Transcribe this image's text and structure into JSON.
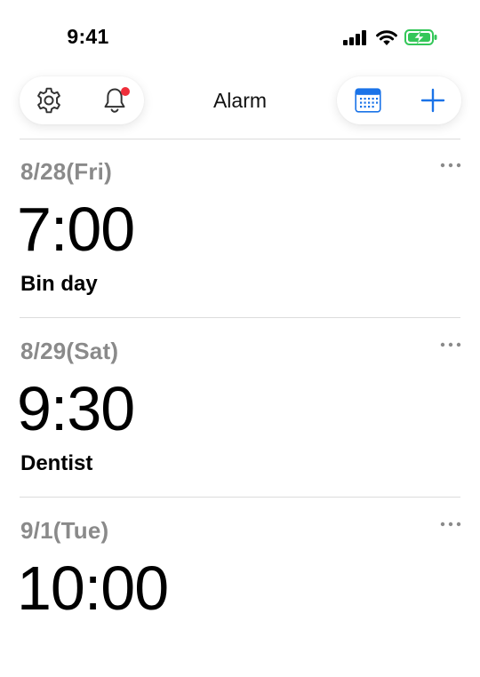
{
  "status_bar": {
    "time": "9:41",
    "icons": [
      "cellular-signal-icon",
      "wifi-icon",
      "battery-charging-icon"
    ],
    "battery_color": "#34c759"
  },
  "header": {
    "title": "Alarm",
    "left_buttons": [
      "gear-icon",
      "bell-icon"
    ],
    "right_buttons": [
      "calendar-icon",
      "plus-icon"
    ],
    "notification_dot": true,
    "accent_color": "#1a73e8"
  },
  "alarms": [
    {
      "date": "8/28(Fri)",
      "time": "7:00",
      "label": "Bin day"
    },
    {
      "date": "8/29(Sat)",
      "time": "9:30",
      "label": "Dentist"
    },
    {
      "date": "9/1(Tue)",
      "time": "10:00",
      "label": ""
    }
  ]
}
